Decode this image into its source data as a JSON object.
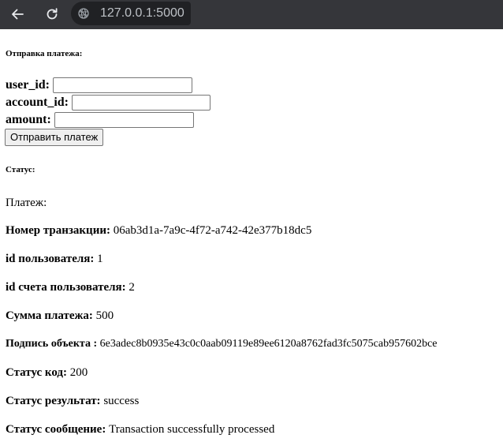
{
  "browser": {
    "url": "127.0.0.1:5000",
    "back_icon": "arrow-left-icon",
    "reload_icon": "reload-icon",
    "site_icon": "globe-icon"
  },
  "form": {
    "title": "Отправка платежа:",
    "fields": [
      {
        "label": "user_id:",
        "value": ""
      },
      {
        "label": "account_id:",
        "value": ""
      },
      {
        "label": "amount:",
        "value": ""
      }
    ],
    "submit_label": "Отправить платеж"
  },
  "status": {
    "title": "Статус:",
    "payment_heading": "Платеж:",
    "rows": [
      {
        "label": "Номер транзакции:",
        "value": "06ab3d1a-7a9c-4f72-a742-42e377b18dc5"
      },
      {
        "label": "id пользователя:",
        "value": "1"
      },
      {
        "label": "id счета пользователя:",
        "value": "2"
      },
      {
        "label": "Сумма платежа:",
        "value": "500"
      },
      {
        "label": "Подпись объекта :",
        "value": "6e3adec8b0935e43c0c0aab09119e89ee6120a8762fad3fc5075cab957602bce"
      },
      {
        "label": "Статус код:",
        "value": "200"
      },
      {
        "label": "Статус результат:",
        "value": "success"
      },
      {
        "label": "Статус сообщение:",
        "value": "Transaction successfully processed"
      }
    ]
  }
}
